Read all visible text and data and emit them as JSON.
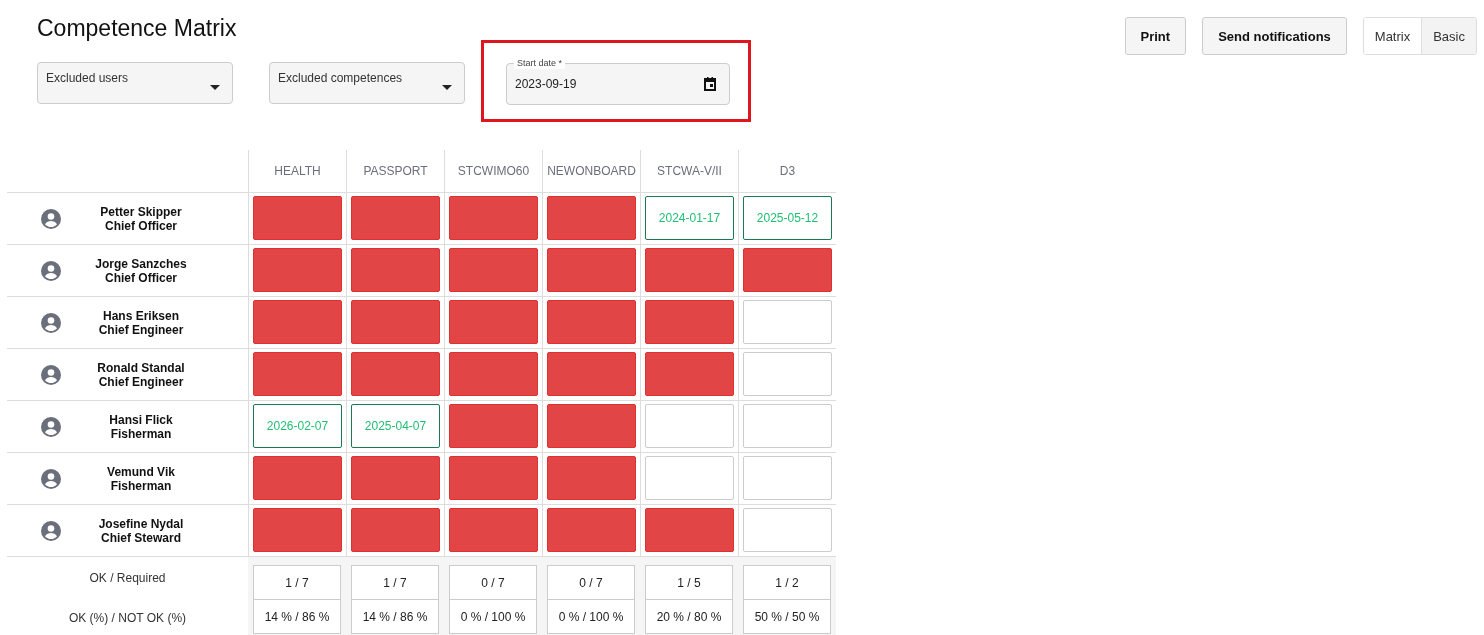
{
  "title": "Competence Matrix",
  "actions": [
    "Print",
    "Send notifications"
  ],
  "views": [
    {
      "label": "Matrix",
      "selected": true
    },
    {
      "label": "Basic",
      "selected": false
    }
  ],
  "filters": [
    {
      "kind": "select",
      "placeholder": "Excluded users"
    },
    {
      "kind": "select",
      "placeholder": "Excluded competences"
    },
    {
      "kind": "date",
      "label": "Start date *",
      "value": "2023-09-19",
      "highlighted": true
    }
  ],
  "columns": [
    "HEALTH",
    "PASSPORT",
    "STCWIMO60",
    "NEWONBOARD",
    "STCWA-V/II",
    "D3"
  ],
  "rows": [
    {
      "name": "Petter Skipper",
      "role": "Chief Officer",
      "cells": [
        {
          "kind": "missing"
        },
        {
          "kind": "missing"
        },
        {
          "kind": "missing"
        },
        {
          "kind": "missing"
        },
        {
          "kind": "valid",
          "date": "2024-01-17"
        },
        {
          "kind": "valid",
          "date": "2025-05-12"
        }
      ]
    },
    {
      "name": "Jorge Sanzches",
      "role": "Chief Officer",
      "cells": [
        {
          "kind": "missing"
        },
        {
          "kind": "missing"
        },
        {
          "kind": "missing"
        },
        {
          "kind": "missing"
        },
        {
          "kind": "missing"
        },
        {
          "kind": "missing"
        }
      ]
    },
    {
      "name": "Hans Eriksen",
      "role": "Chief Engineer",
      "cells": [
        {
          "kind": "missing"
        },
        {
          "kind": "missing"
        },
        {
          "kind": "missing"
        },
        {
          "kind": "missing"
        },
        {
          "kind": "missing"
        },
        {
          "kind": "empty"
        }
      ]
    },
    {
      "name": "Ronald Standal",
      "role": "Chief Engineer",
      "cells": [
        {
          "kind": "missing"
        },
        {
          "kind": "missing"
        },
        {
          "kind": "missing"
        },
        {
          "kind": "missing"
        },
        {
          "kind": "missing"
        },
        {
          "kind": "empty"
        }
      ]
    },
    {
      "name": "Hansi Flick",
      "role": "Fisherman",
      "cells": [
        {
          "kind": "valid",
          "date": "2026-02-07"
        },
        {
          "kind": "valid",
          "date": "2025-04-07"
        },
        {
          "kind": "missing"
        },
        {
          "kind": "missing"
        },
        {
          "kind": "empty"
        },
        {
          "kind": "empty"
        }
      ]
    },
    {
      "name": "Vemund Vik",
      "role": "Fisherman",
      "cells": [
        {
          "kind": "missing"
        },
        {
          "kind": "missing"
        },
        {
          "kind": "missing"
        },
        {
          "kind": "missing"
        },
        {
          "kind": "empty"
        },
        {
          "kind": "empty"
        }
      ]
    },
    {
      "name": "Josefine Nydal",
      "role": "Chief Steward",
      "cells": [
        {
          "kind": "missing"
        },
        {
          "kind": "missing"
        },
        {
          "kind": "missing"
        },
        {
          "kind": "missing"
        },
        {
          "kind": "missing"
        },
        {
          "kind": "empty"
        }
      ]
    }
  ],
  "summary": {
    "labels": [
      "OK / Required",
      "OK (%) / NOT OK (%)"
    ],
    "counts": [
      "1 / 7",
      "1 / 7",
      "0 / 7",
      "0 / 7",
      "1 / 5",
      "1 / 2"
    ],
    "percents": [
      "14 % / 86 %",
      "14 % / 86 %",
      "0 % / 100 %",
      "0 % / 100 %",
      "20 % / 80 %",
      "50 % / 50 %"
    ]
  }
}
